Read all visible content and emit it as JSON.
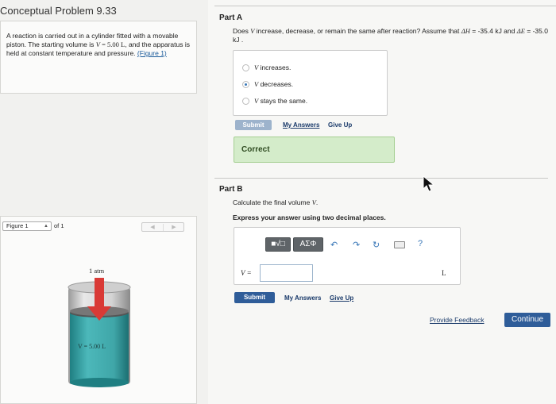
{
  "problem": {
    "title": "Conceptual Problem 9.33",
    "text_1": "A reaction is carried out in a cylinder fitted with a movable piston. The starting volume is ",
    "var_v": "V",
    "eq_value": " = 5.00 L",
    "text_2": ", and the apparatus is held at constant temperature and pressure.",
    "figure_link": "(Figure 1)"
  },
  "figure": {
    "select_value": "Figure 1",
    "of_text": "of 1",
    "prev_icon": "chevron-left-icon",
    "next_icon": "chevron-right-icon",
    "atm_label": "1 atm",
    "volume_label": "V = 5.00 L",
    "colors": {
      "liquid": "#3fa6a8",
      "arrow": "#d93a36",
      "piston": "#666"
    }
  },
  "partA": {
    "label": "Part A",
    "question_1": "Does ",
    "q_var": "V",
    "question_2": " increase, decrease, or remain the same after reaction? Assume that ",
    "dh": "ΔH",
    "question_3": " = -35.4 kJ and ",
    "de": "ΔE",
    "question_4": " = -35.0 kJ .",
    "choices": [
      {
        "var": "V",
        "text": " increases.",
        "selected": false
      },
      {
        "var": "V",
        "text": " decreases.",
        "selected": true
      },
      {
        "var": "V",
        "text": " stays the same.",
        "selected": false
      }
    ],
    "submit": "Submit",
    "my_answers": "My Answers",
    "give_up": "Give Up",
    "result": "Correct"
  },
  "partB": {
    "label": "Part B",
    "calc_1": "Calculate the final volume ",
    "calc_var": "V",
    "calc_2": ".",
    "express": "Express your answer using two decimal places.",
    "toolbar": {
      "template_btn": "■√□",
      "symbols_btn": "ΑΣΦ",
      "undo_icon": "undo-icon",
      "redo_icon": "redo-icon",
      "reset_icon": "reset-icon",
      "keyboard_icon": "keyboard-icon",
      "help": "?"
    },
    "v_label": "V =",
    "input_value": "",
    "unit": "L",
    "submit": "Submit",
    "my_answers": "My Answers",
    "give_up": "Give Up"
  },
  "footer": {
    "feedback": "Provide Feedback",
    "continue": "Continue"
  }
}
